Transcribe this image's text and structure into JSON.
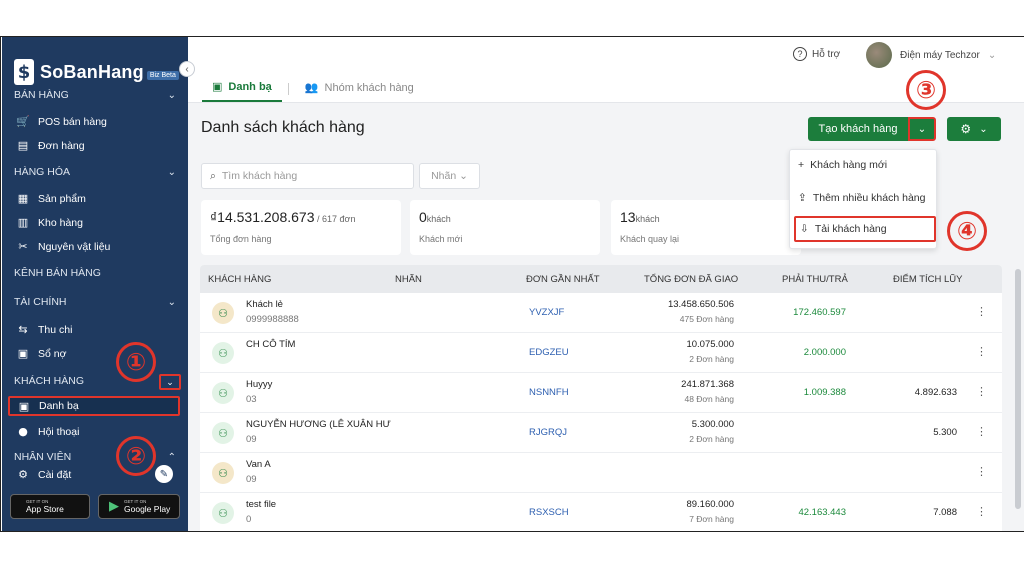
{
  "brand": {
    "logo_mark": "$",
    "name": "SoBanHang",
    "badge": "Biz Beta"
  },
  "sidebar": {
    "collapse_icon": "‹",
    "sections": [
      {
        "label": "BÁN HÀNG",
        "chev": "⌄"
      },
      {
        "label": "HÀNG HÓA",
        "chev": "⌄"
      },
      {
        "label": "KÊNH BÁN HÀNG",
        "chev": ""
      },
      {
        "label": "TÀI CHÍNH",
        "chev": "⌄"
      },
      {
        "label": "KHÁCH HÀNG",
        "chev": "⌄"
      },
      {
        "label": "NHÂN VIÊN",
        "chev": "⌃"
      }
    ],
    "items": [
      {
        "label": "POS bán hàng",
        "icon": "cart-icon",
        "glyph": "🛒"
      },
      {
        "label": "Đơn hàng",
        "icon": "receipt-icon",
        "glyph": "▤"
      },
      {
        "label": "Sản phẩm",
        "icon": "box-icon",
        "glyph": "▦"
      },
      {
        "label": "Kho hàng",
        "icon": "warehouse-icon",
        "glyph": "▥"
      },
      {
        "label": "Nguyên vật liệu",
        "icon": "utensils-icon",
        "glyph": "✂"
      },
      {
        "label": "Thu chi",
        "icon": "transfer-icon",
        "glyph": "⇆"
      },
      {
        "label": "Sổ nợ",
        "icon": "ledger-icon",
        "glyph": "▣"
      },
      {
        "label": "Danh bạ",
        "icon": "contacts-icon",
        "glyph": "▣"
      },
      {
        "label": "Hội thoại",
        "icon": "chat-icon",
        "glyph": "●"
      },
      {
        "label": "Cài đặt",
        "icon": "gear-icon",
        "glyph": "⚙"
      }
    ],
    "store": {
      "apple_small": "GET IT ON",
      "apple": "App Store",
      "apple_glyph": "",
      "google_small": "GET IT ON",
      "google": "Google Play",
      "google_glyph": "▶"
    }
  },
  "annotations": [
    "①",
    "②",
    "③",
    "④"
  ],
  "topbar": {
    "help": "Hỗ trợ",
    "help_icon": "?",
    "user": "Điện máy Techzor",
    "user_chev": "⌄"
  },
  "tabs": [
    {
      "label": "Danh bạ",
      "glyph": "▣"
    },
    {
      "label": "Nhóm khách hàng",
      "glyph": "👥"
    }
  ],
  "page": {
    "title": "Danh sách khách hàng",
    "create_button": "Tạo khách hàng",
    "caret": "⌄",
    "gear": "⚙",
    "gear_caret": "⌄",
    "search_placeholder": "Tìm khách hàng",
    "search_icon": "⌕",
    "label_filter": "Nhãn ⌄"
  },
  "stats": [
    {
      "value": "₫14.531.208.673",
      "suffix": " / 617 đơn",
      "label": "Tổng đơn hàng"
    },
    {
      "value": "0",
      "suffix": "khách",
      "label": "Khách mới"
    },
    {
      "value": "13",
      "suffix": "khách",
      "label": "Khách quay lại"
    }
  ],
  "dropdown": [
    {
      "label": "Khách hàng mới",
      "glyph": "+"
    },
    {
      "label": "Thêm nhiều khách hàng",
      "glyph": "⇪"
    },
    {
      "label": "Tải khách hàng",
      "glyph": "⇩"
    }
  ],
  "table": {
    "headers": [
      "KHÁCH HÀNG",
      "NHÃN",
      "ĐƠN GẦN NHẤT",
      "TỔNG ĐƠN ĐÃ GIAO",
      "PHẢI THU/TRẢ",
      "ĐIỂM TÍCH LŨY"
    ],
    "rows": [
      {
        "name": "Khách lẻ",
        "phone": "0999988888",
        "code": "YVZXJF",
        "total": "13.458.650.506",
        "count": "475 Đơn hàng",
        "due": "172.460.597",
        "points": "",
        "img": true
      },
      {
        "name": "CH CÔ TÍM",
        "phone": "",
        "code": "EDGZEU",
        "total": "10.075.000",
        "count": "2 Đơn hàng",
        "due": "2.000.000",
        "points": "",
        "img": false
      },
      {
        "name": "Huyyy",
        "phone": "03",
        "code": "NSNNFH",
        "total": "241.871.368",
        "count": "48 Đơn hàng",
        "due": "1.009.388",
        "points": "4.892.633",
        "img": false
      },
      {
        "name": "NGUYỄN HƯƠNG (LÊ XUÂN HƯ",
        "phone": "09",
        "code": "RJGRQJ",
        "total": "5.300.000",
        "count": "2 Đơn hàng",
        "due": "",
        "points": "5.300",
        "img": false
      },
      {
        "name": "Van A",
        "phone": "09",
        "code": "",
        "total": "",
        "count": "",
        "due": "",
        "points": "",
        "img": true
      },
      {
        "name": "test file",
        "phone": "0",
        "code": "RSXSCH",
        "total": "89.160.000",
        "count": "7 Đơn hàng",
        "due": "42.163.443",
        "points": "7.088",
        "img": false
      }
    ],
    "more_glyph": "⋮",
    "person_glyph": "⚇"
  },
  "colors": {
    "sidebar": "#1f3a60",
    "accent_green": "#1c7d3c",
    "annotation_red": "#e0352b",
    "link_blue": "#2d5fb0"
  }
}
